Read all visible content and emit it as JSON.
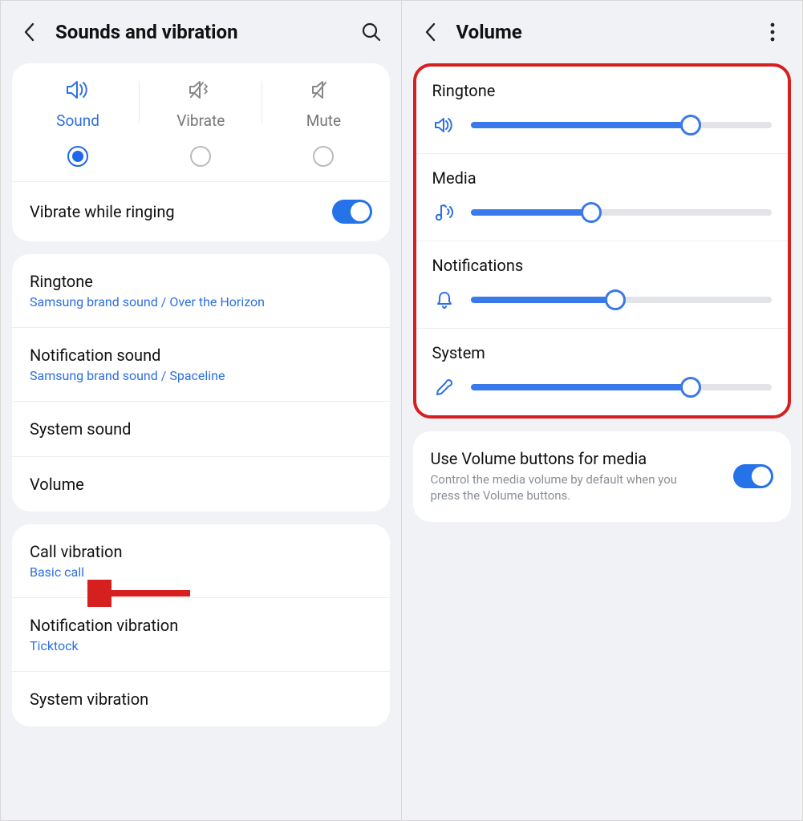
{
  "left": {
    "title": "Sounds and vibration",
    "modes": {
      "sound": "Sound",
      "vibrate": "Vibrate",
      "mute": "Mute"
    },
    "vibrate_while_ringing": "Vibrate while ringing",
    "ringtone": {
      "label": "Ringtone",
      "sub": "Samsung brand sound / Over the Horizon"
    },
    "notification_sound": {
      "label": "Notification sound",
      "sub": "Samsung brand sound / Spaceline"
    },
    "system_sound": {
      "label": "System sound"
    },
    "volume": {
      "label": "Volume"
    },
    "call_vibration": {
      "label": "Call vibration",
      "sub": "Basic call"
    },
    "notification_vibration": {
      "label": "Notification vibration",
      "sub": "Ticktock"
    },
    "system_vibration": {
      "label": "System vibration"
    }
  },
  "right": {
    "title": "Volume",
    "sliders": {
      "ringtone": {
        "label": "Ringtone",
        "value": 73
      },
      "media": {
        "label": "Media",
        "value": 40
      },
      "notifications": {
        "label": "Notifications",
        "value": 48
      },
      "system": {
        "label": "System",
        "value": 73
      }
    },
    "use_buttons": {
      "label": "Use Volume buttons for media",
      "sub": "Control the media volume by default when you press the Volume buttons."
    }
  }
}
